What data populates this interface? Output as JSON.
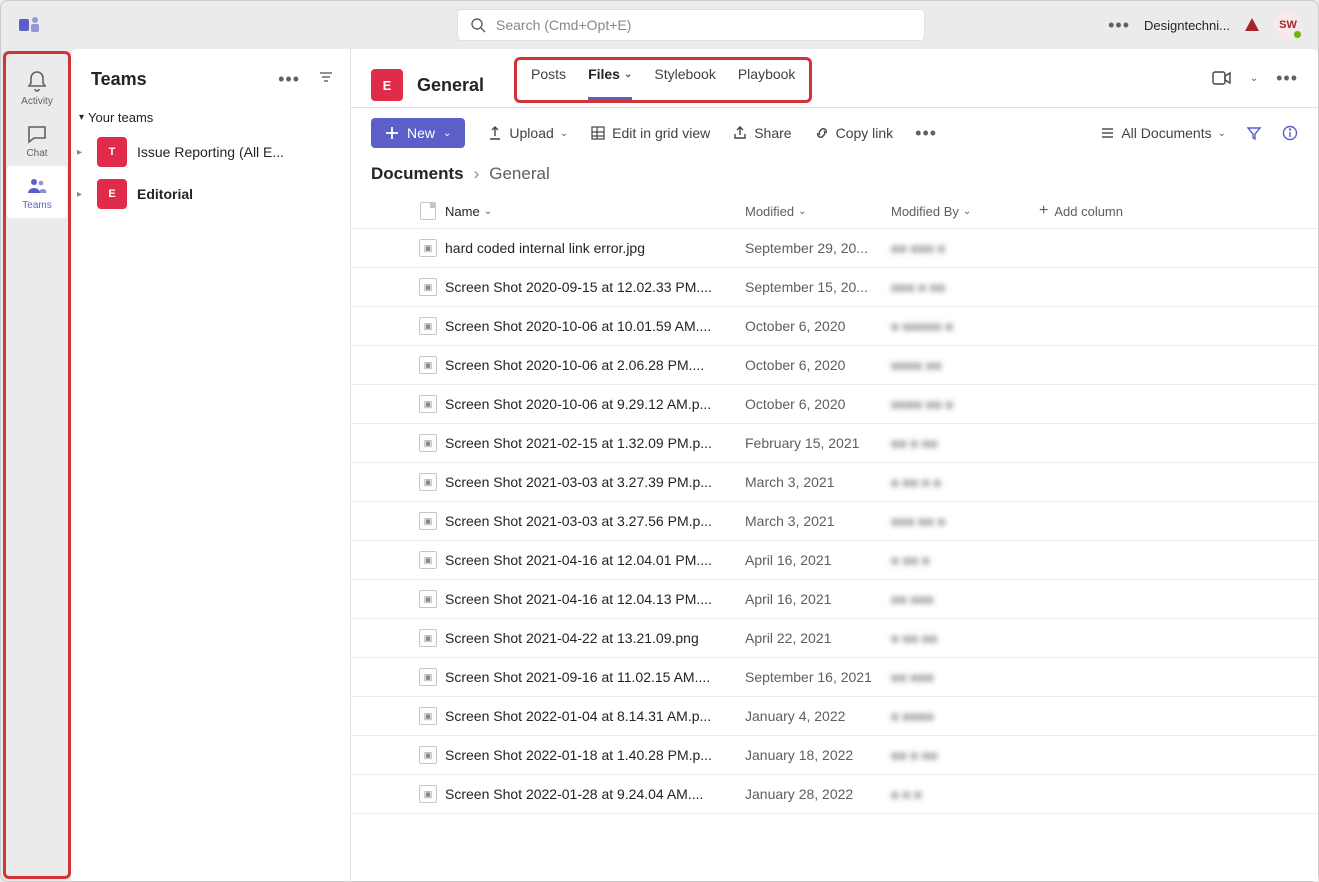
{
  "search": {
    "placeholder": "Search (Cmd+Opt+E)"
  },
  "topbar": {
    "org": "Designtechni...",
    "avatar": "SW"
  },
  "rail": {
    "activity": "Activity",
    "chat": "Chat",
    "teams": "Teams"
  },
  "teamsPanel": {
    "title": "Teams",
    "section": "Your teams",
    "items": [
      {
        "badge": "T",
        "name": "Issue Reporting (All E..."
      },
      {
        "badge": "E",
        "name": "Editorial"
      }
    ]
  },
  "channel": {
    "badge": "E",
    "name": "General",
    "tabs": [
      "Posts",
      "Files",
      "Stylebook",
      "Playbook"
    ],
    "activeTab": 1
  },
  "toolbar": {
    "new": "New",
    "upload": "Upload",
    "editGrid": "Edit in grid view",
    "share": "Share",
    "copyLink": "Copy link",
    "allDocs": "All Documents"
  },
  "breadcrumb": {
    "root": "Documents",
    "current": "General"
  },
  "columns": {
    "name": "Name",
    "modified": "Modified",
    "modifiedBy": "Modified By",
    "add": "Add column"
  },
  "files": [
    {
      "name": "hard coded internal link error.jpg",
      "modified": "September 29, 20...",
      "by": "■■ ■■■ ■"
    },
    {
      "name": "Screen Shot 2020-09-15 at 12.02.33 PM....",
      "modified": "September 15, 20...",
      "by": "■■■ ■ ■■"
    },
    {
      "name": "Screen Shot 2020-10-06 at 10.01.59 AM....",
      "modified": "October 6, 2020",
      "by": "■ ■■■■■ ■"
    },
    {
      "name": "Screen Shot 2020-10-06 at 2.06.28 PM....",
      "modified": "October 6, 2020",
      "by": "■■■■ ■■"
    },
    {
      "name": "Screen Shot 2020-10-06 at 9.29.12 AM.p...",
      "modified": "October 6, 2020",
      "by": "■■■■   ■■ ■"
    },
    {
      "name": "Screen Shot 2021-02-15 at 1.32.09 PM.p...",
      "modified": "February 15, 2021",
      "by": "■■ ■ ■■"
    },
    {
      "name": "Screen Shot 2021-03-03 at 3.27.39 PM.p...",
      "modified": "March 3, 2021",
      "by": "■ ■■ ■ ■"
    },
    {
      "name": "Screen Shot 2021-03-03 at 3.27.56 PM.p...",
      "modified": "March 3, 2021",
      "by": "■■■ ■■ ■"
    },
    {
      "name": "Screen Shot 2021-04-16 at 12.04.01 PM....",
      "modified": "April 16, 2021",
      "by": "■   ■■  ■"
    },
    {
      "name": "Screen Shot 2021-04-16 at 12.04.13 PM....",
      "modified": "April 16, 2021",
      "by": "■■ ■■■"
    },
    {
      "name": "Screen Shot 2021-04-22 at 13.21.09.png",
      "modified": "April 22, 2021",
      "by": "■  ■■  ■■"
    },
    {
      "name": "Screen Shot 2021-09-16 at 11.02.15 AM....",
      "modified": "September 16, 2021",
      "by": "■■  ■■■"
    },
    {
      "name": "Screen Shot 2022-01-04 at 8.14.31 AM.p...",
      "modified": "January 4, 2022",
      "by": "■  ■■■■"
    },
    {
      "name": "Screen Shot 2022-01-18 at 1.40.28 PM.p...",
      "modified": "January 18, 2022",
      "by": "■■ ■ ■■"
    },
    {
      "name": "Screen Shot 2022-01-28 at 9.24.04 AM....",
      "modified": "January 28, 2022",
      "by": "■   ■  ■"
    }
  ]
}
